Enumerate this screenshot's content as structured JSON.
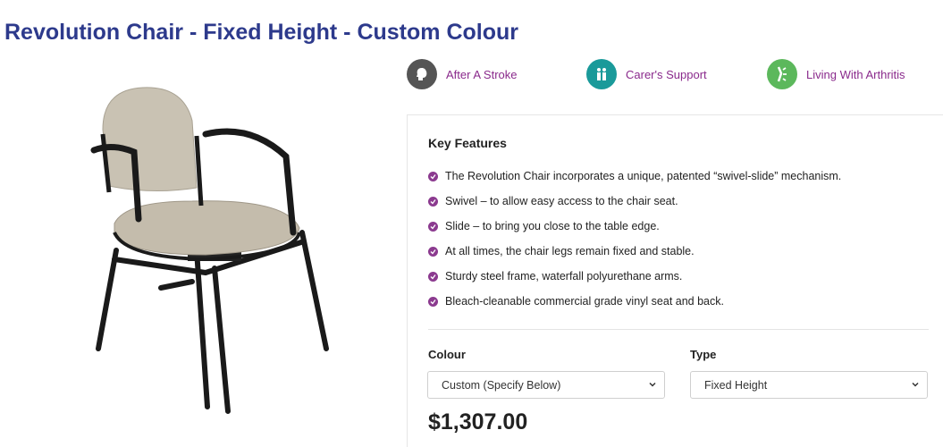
{
  "product": {
    "title": "Revolution Chair - Fixed Height - Custom Colour",
    "price": "$1,307.00"
  },
  "badges": [
    {
      "label": "After A Stroke",
      "icon": "head-icon",
      "color": "#555555"
    },
    {
      "label": "Carer's Support",
      "icon": "people-icon",
      "color": "#1a9a9a"
    },
    {
      "label": "Living With Arthritis",
      "icon": "joint-icon",
      "color": "#5cb85c"
    }
  ],
  "key_features": {
    "title": "Key Features",
    "items": [
      "The Revolution Chair incorporates a unique, patented “swivel-slide” mechanism.",
      "Swivel – to allow easy access to the chair seat.",
      "Slide – to bring you close to the table edge.",
      "At all times, the chair legs remain fixed and stable.",
      "Sturdy steel frame, waterfall polyurethane arms.",
      "Bleach-cleanable commercial grade vinyl seat and back."
    ]
  },
  "options": {
    "colour": {
      "label": "Colour",
      "selected": "Custom (Specify Below)"
    },
    "type": {
      "label": "Type",
      "selected": "Fixed Height"
    }
  },
  "colors": {
    "title": "#2d3a8c",
    "accent": "#8b3a8f"
  }
}
